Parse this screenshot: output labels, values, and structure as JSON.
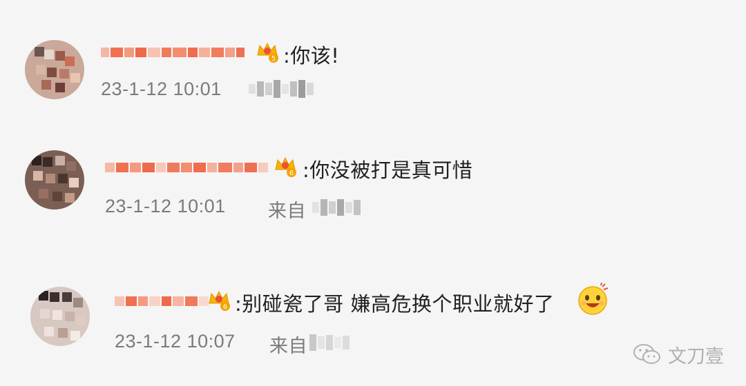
{
  "comments": [
    {
      "message": ":你该!",
      "timestamp": "23-1-12 10:01",
      "source": "",
      "badge_level": "5"
    },
    {
      "message": ":你没被打是真可惜",
      "timestamp": "23-1-12 10:01",
      "source": "来自",
      "badge_level": "6"
    },
    {
      "message": ":别碰瓷了哥 嫌高危换个职业就好了",
      "timestamp": "23-1-12 10:07",
      "source": "来自",
      "badge_level": "6"
    }
  ],
  "watermark": {
    "text": "文刀壹",
    "icon": "wechat-icon"
  },
  "colors": {
    "background": "#f5f5f5",
    "text": "#202020",
    "meta": "#7a7a7a",
    "badge": "#f5b400",
    "name_mosaic": "#f07050"
  }
}
